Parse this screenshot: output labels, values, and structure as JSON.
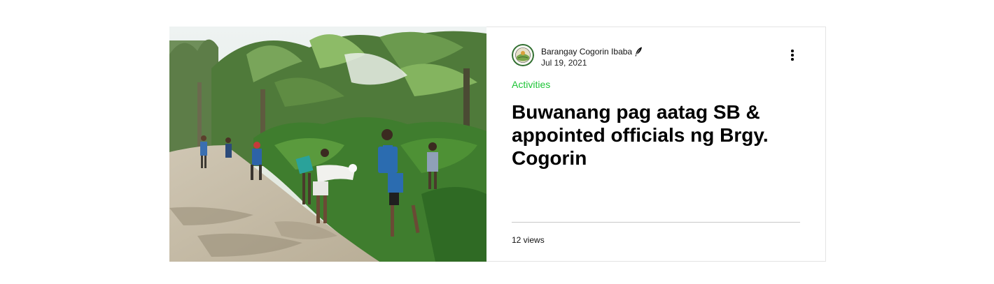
{
  "post": {
    "author_name": "Barangay Cogorin Ibaba",
    "date": "Jul 19, 2021",
    "category": "Activities",
    "title": "Buwanang pag aatag SB & appointed officials ng Brgy. Cogorin",
    "views": "12 views"
  },
  "icons": {
    "author_badge": "quill-icon",
    "menu": "more-vertical-icon"
  },
  "colors": {
    "category": "#1dc436",
    "border": "#e4e4e4",
    "divider": "#c8c8c8"
  }
}
